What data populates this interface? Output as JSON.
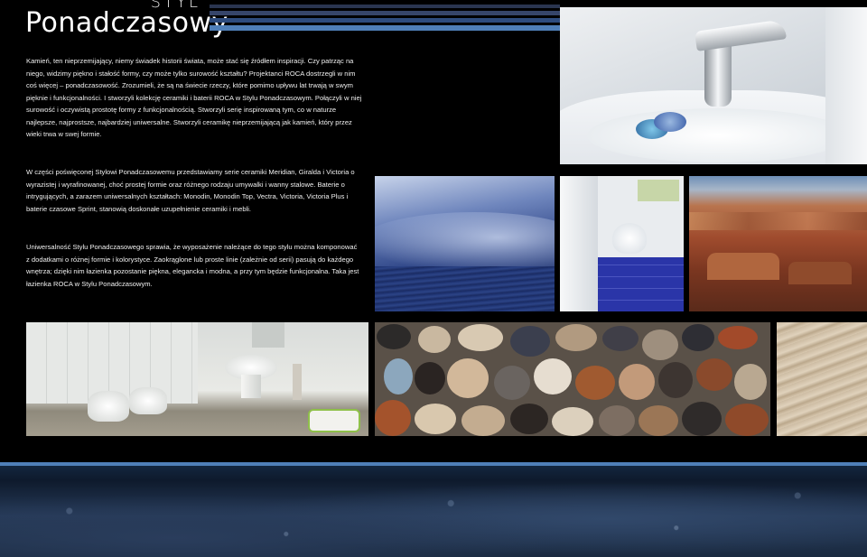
{
  "header": {
    "title_small": "STYL",
    "title_main": "Ponadczasowy"
  },
  "paragraphs": [
    "Kamień, ten nieprzemijający, niemy świadek historii świata, może stać się źródłem inspiracji. Czy patrząc na niego, widzimy piękno i stałość formy, czy może tylko surowość kształtu? Projektanci ROCA dostrzegli w nim coś więcej – ponadczasowość. Zrozumieli, że są na świecie rzeczy, które pomimo upływu lat trwają w swym pięknie i funkcjonalności. I stworzyli kolekcję ceramiki i baterii ROCA w Stylu Ponadczasowym. Połączyli w niej surowość i oczywistą prostotę formy z funkcjonalnością. Stworzyli serię inspirowaną tym, co w naturze najlepsze, najprostsze, najbardziej uniwersalne. Stworzyli ceramikę nieprzemijającą jak kamień, który przez wieki trwa w swej formie.",
    "W części poświęconej Stylowi Ponadczasowemu przedstawiamy serie ceramiki Meridian, Giralda i Victoria o wyrazistej i wyrafinowanej, choć prostej formie oraz różnego rodzaju umywalki i wanny stalowe. Baterie o intrygujących, a zarazem uniwersalnych kształtach: Monodin, Monodin Top, Vectra, Victoria, Victoria Plus i baterie czasowe Sprint, stanowią doskonałe uzupełnienie ceramiki i mebli.",
    "Uniwersalność Stylu Ponadczasowego sprawia, że wyposażenie należące do tego stylu można komponować z dodatkami o różnej formie i kolorystyce. Zaokrąglone lub proste linie (zależnie od serii) pasują do każdego wnętrza; dzięki nim łazienka pozostanie piękna, elegancka i modna, a przy tym będzie funkcjonalna. Taka jest łazienka ROCA w Stylu Ponadczasowym."
  ],
  "colors": {
    "background": "#000000",
    "accent_blue": "#4f7fb8",
    "stripe_dark": "#1d2a44",
    "stripe_mid": "#3b5b8c"
  },
  "images": {
    "faucet": "faucet-photo",
    "water": "water-wave-photo",
    "bathroom_blue": "blue-tile-bathroom-photo",
    "canyon": "canyon-landscape-photo",
    "bathroom_white": "white-bathroom-photo",
    "pebbles": "pebbles-photo",
    "sand": "sand-ripples-photo"
  }
}
